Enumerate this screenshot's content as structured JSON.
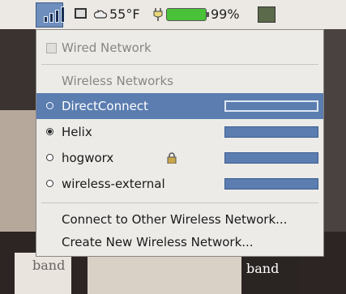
{
  "panel": {
    "weather": "55°F",
    "battery": "99%",
    "battery_level": 0.99,
    "icons": [
      "network-icon",
      "screen-icon",
      "weather-icon",
      "power-plug-icon",
      "battery-icon",
      "cpu-monitor-icon"
    ]
  },
  "background": {
    "text_left": "band",
    "text_right": "band"
  },
  "menu": {
    "wired_label": "Wired Network",
    "wireless_header": "Wireless Networks",
    "networks": [
      {
        "name": "DirectConnect",
        "selected": true,
        "active": false,
        "secured": false
      },
      {
        "name": "Helix",
        "selected": false,
        "active": true,
        "secured": false
      },
      {
        "name": "hogworx",
        "selected": false,
        "active": false,
        "secured": true
      },
      {
        "name": "wireless-external",
        "selected": false,
        "active": false,
        "secured": false
      }
    ],
    "connect_other": "Connect to Other Wireless Network...",
    "create_new": "Create New Wireless Network..."
  }
}
